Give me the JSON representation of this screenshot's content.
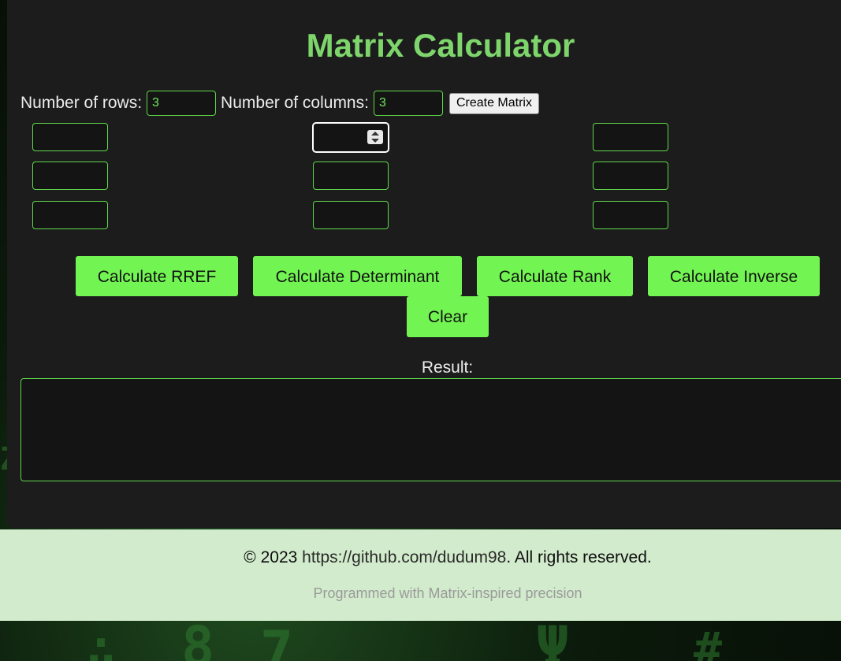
{
  "title": "Matrix Calculator",
  "dimensions": {
    "rows_label": "Number of rows:",
    "rows_value": "3",
    "columns_label": "Number of columns:",
    "columns_value": "3",
    "create_button": "Create Matrix"
  },
  "matrix": {
    "rows": 3,
    "columns": 3,
    "cells": [
      [
        "",
        "",
        ""
      ],
      [
        "",
        "",
        ""
      ],
      [
        "",
        "",
        ""
      ]
    ],
    "focused_cell": "row-1-col-2"
  },
  "actions": {
    "rref": "Calculate RREF",
    "determinant": "Calculate Determinant",
    "rank": "Calculate Rank",
    "inverse": "Calculate Inverse",
    "clear": "Clear"
  },
  "result": {
    "label": "Result:",
    "value": ""
  },
  "footer": {
    "copyright_prefix": "© 2023 ",
    "link_text": "https://github.com/dudum98",
    "copyright_suffix": ". All rights reserved.",
    "tagline": "Programmed with Matrix-inspired precision"
  },
  "colors": {
    "accent": "#72f552",
    "title": "#7ed56c",
    "panel": "#1c1c1c",
    "footer_bg": "#d2ebcc"
  }
}
